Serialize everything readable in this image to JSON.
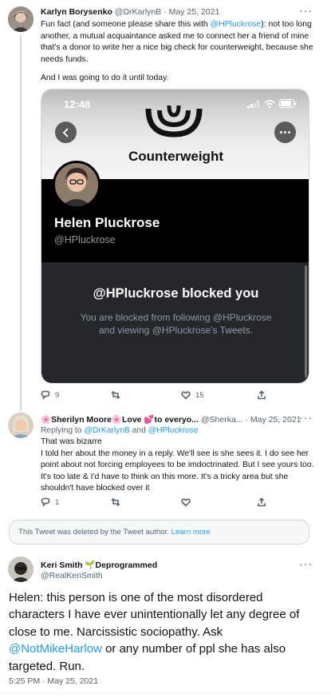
{
  "tweet1": {
    "name": "Karlyn Borysenko",
    "handle": "@DrKarlynB",
    "sep": "·",
    "date": "May 25, 2021",
    "more": "···",
    "text_p1_a": "Fun fact (and someone please share this with ",
    "text_p1_mention": "@HPluckrose",
    "text_p1_b": "): not too long another, a mutual acquaintance asked me to connect her a friend of mine that's a donor to write her a nice big check for counterweight, because she needs funds.",
    "text_p2": "And I was going to do it until today.",
    "embed": {
      "time": "12:48",
      "logo_text": "Counterweight",
      "profile_name": "Helen Pluckrose",
      "profile_handle": "@HPluckrose",
      "blocked_title": "@HPluckrose blocked you",
      "blocked_sub_1": "You are blocked from following @HPluckrose",
      "blocked_sub_2": "and viewing @HPluckrose's Tweets."
    },
    "replies": "9",
    "retweets": "",
    "likes": "15"
  },
  "tweet2": {
    "name": "🌸Sherilyn Moore🌸Love 💕to everyo...",
    "handle": "@Sherka...",
    "sep": "·",
    "date": "May 25, 2021",
    "more": "···",
    "replying_to_label": "Replying to ",
    "replying_to_1": "@DrKarlynB",
    "replying_and": " and ",
    "replying_to_2": "@HPluckrose",
    "text": "That was bizarre\nI told her about the money in a reply. We'll see is she sees it. I do see her point about not forcing employees to be imdoctrinated. But I see yours too. It's too late & I'd have to think on this more. It's a tricky area but she shouldn't have blocked over it",
    "replies": "1",
    "retweets": "",
    "likes": ""
  },
  "deleted": {
    "text": "This Tweet was deleted by the Tweet author. ",
    "link": "Learn more"
  },
  "tweet3": {
    "name": "Keri Smith 🌱Deprogrammed",
    "handle": "@RealKeriSmith",
    "more": "···",
    "text_a": "Helen: this person is one of the most disordered characters I have ever unintentionally let any degree of close to me. Narcissistic sociopathy. Ask ",
    "mention": "@NotMikeHarlow",
    "text_b": " or any number of ppl she has also targeted. Run.",
    "timestamp": "5:25 PM · May 25, 2021"
  },
  "colors": {
    "accent": "#1d9bf0",
    "text": "#0f1419",
    "muted": "#536471",
    "embed_dark": "#25272b"
  },
  "icons": [
    "reply-icon",
    "retweet-icon",
    "like-icon",
    "share-icon",
    "back-icon",
    "more-icon",
    "counterweight-logo",
    "signal-icon",
    "wifi-icon",
    "battery-icon"
  ]
}
